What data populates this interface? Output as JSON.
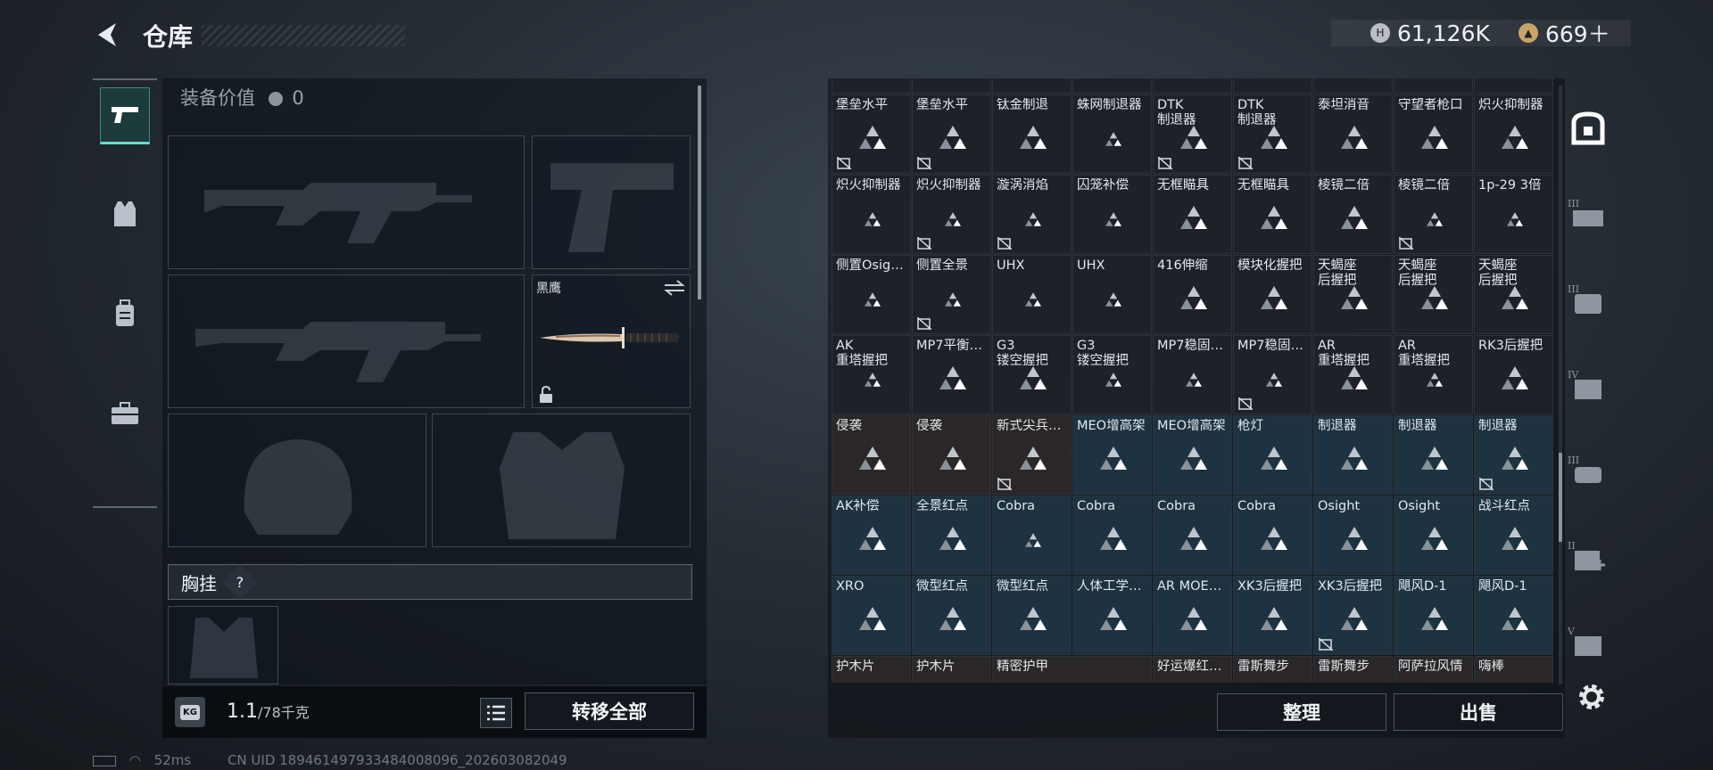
{
  "header": {
    "title": "仓库",
    "currency_1": "61,126K",
    "currency_2": "669＋"
  },
  "left_panel": {
    "equipment_value_label": "装备价值",
    "equipment_value": "0",
    "knife_name": "黑鹰",
    "chest_rig_label": "胸挂",
    "chest_rig_help": "?",
    "weight_current": "1.1",
    "weight_max": "/78千克",
    "weight_icon_label": "KG",
    "transfer_all_label": "转移全部"
  },
  "grid": {
    "rows": [
      [
        {
          "n": "堡垒水平",
          "t": 0,
          "s": 2,
          "x": 1
        },
        {
          "n": "堡垒水平",
          "t": 0,
          "s": 2,
          "x": 1
        },
        {
          "n": "钛金制退",
          "t": 0,
          "s": 2,
          "x": 0
        },
        {
          "n": "蛛网制退器",
          "t": 0,
          "s": 1,
          "x": 0
        },
        {
          "n": "DTK\n制退器",
          "t": 0,
          "s": 2,
          "x": 1
        },
        {
          "n": "DTK\n制退器",
          "t": 0,
          "s": 2,
          "x": 1
        },
        {
          "n": "泰坦消音",
          "t": 0,
          "s": 2,
          "x": 0
        },
        {
          "n": "守望者枪口",
          "t": 0,
          "s": 2,
          "x": 0
        },
        {
          "n": "炽火抑制器",
          "t": 0,
          "s": 2,
          "x": 0
        }
      ],
      [
        {
          "n": "炽火抑制器",
          "t": 0,
          "s": 1,
          "x": 0
        },
        {
          "n": "炽火抑制器",
          "t": 0,
          "s": 1,
          "x": 1
        },
        {
          "n": "漩涡消焰",
          "t": 0,
          "s": 1,
          "x": 1
        },
        {
          "n": "囚笼补偿",
          "t": 0,
          "s": 1,
          "x": 0
        },
        {
          "n": "无框瞄具",
          "t": 0,
          "s": 2,
          "x": 0
        },
        {
          "n": "无框瞄具",
          "t": 0,
          "s": 2,
          "x": 0
        },
        {
          "n": "棱镜二倍",
          "t": 0,
          "s": 2,
          "x": 0
        },
        {
          "n": "棱镜二倍",
          "t": 0,
          "s": 1,
          "x": 1
        },
        {
          "n": "1p-29 3倍",
          "t": 0,
          "s": 1,
          "x": 0
        }
      ],
      [
        {
          "n": "侧置Osig…",
          "t": 0,
          "s": 1,
          "x": 0
        },
        {
          "n": "侧置全景",
          "t": 0,
          "s": 1,
          "x": 1
        },
        {
          "n": "UHX",
          "t": 0,
          "s": 1,
          "x": 0
        },
        {
          "n": "UHX",
          "t": 0,
          "s": 1,
          "x": 0
        },
        {
          "n": "416伸缩",
          "t": 0,
          "s": 2,
          "x": 0
        },
        {
          "n": "模块化握把",
          "t": 0,
          "s": 2,
          "x": 0
        },
        {
          "n": "天蝎座\n后握把",
          "t": 0,
          "s": 2,
          "x": 0
        },
        {
          "n": "天蝎座\n后握把",
          "t": 0,
          "s": 2,
          "x": 0
        },
        {
          "n": "天蝎座\n后握把",
          "t": 0,
          "s": 2,
          "x": 0
        }
      ],
      [
        {
          "n": "AK\n重塔握把",
          "t": 0,
          "s": 1,
          "x": 0
        },
        {
          "n": "MP7平衡…",
          "t": 0,
          "s": 2,
          "x": 0
        },
        {
          "n": "G3\n镂空握把",
          "t": 0,
          "s": 2,
          "x": 0
        },
        {
          "n": "G3\n镂空握把",
          "t": 0,
          "s": 1,
          "x": 0
        },
        {
          "n": "MP7稳固…",
          "t": 0,
          "s": 1,
          "x": 0
        },
        {
          "n": "MP7稳固…",
          "t": 0,
          "s": 1,
          "x": 1
        },
        {
          "n": "AR\n重塔握把",
          "t": 0,
          "s": 2,
          "x": 0
        },
        {
          "n": "AR\n重塔握把",
          "t": 0,
          "s": 1,
          "x": 0
        },
        {
          "n": "RK3后握把",
          "t": 0,
          "s": 2,
          "x": 0
        }
      ],
      [
        {
          "n": "侵袭",
          "t": 2,
          "s": 2,
          "x": 0
        },
        {
          "n": "侵袭",
          "t": 2,
          "s": 2,
          "x": 0
        },
        {
          "n": "新式尖兵…",
          "t": 2,
          "s": 2,
          "x": 1
        },
        {
          "n": "MEO增高架",
          "t": 1,
          "s": 2,
          "x": 0
        },
        {
          "n": "MEO增高架",
          "t": 1,
          "s": 2,
          "x": 0
        },
        {
          "n": "枪灯",
          "t": 1,
          "s": 2,
          "x": 0
        },
        {
          "n": "制退器",
          "t": 1,
          "s": 2,
          "x": 0
        },
        {
          "n": "制退器",
          "t": 1,
          "s": 2,
          "x": 0
        },
        {
          "n": "制退器",
          "t": 1,
          "s": 2,
          "x": 1
        }
      ],
      [
        {
          "n": "AK补偿",
          "t": 1,
          "s": 2,
          "x": 0
        },
        {
          "n": "全景红点",
          "t": 1,
          "s": 2,
          "x": 0
        },
        {
          "n": "Cobra",
          "t": 1,
          "s": 1,
          "x": 0
        },
        {
          "n": "Cobra",
          "t": 1,
          "s": 2,
          "x": 0
        },
        {
          "n": "Cobra",
          "t": 1,
          "s": 2,
          "x": 0
        },
        {
          "n": "Cobra",
          "t": 1,
          "s": 2,
          "x": 0
        },
        {
          "n": "Osight",
          "t": 1,
          "s": 2,
          "x": 0
        },
        {
          "n": "Osight",
          "t": 1,
          "s": 2,
          "x": 0
        },
        {
          "n": "战斗红点",
          "t": 1,
          "s": 2,
          "x": 0
        }
      ],
      [
        {
          "n": "XRO",
          "t": 1,
          "s": 2,
          "x": 0
        },
        {
          "n": "微型红点",
          "t": 1,
          "s": 2,
          "x": 0
        },
        {
          "n": "微型红点",
          "t": 1,
          "s": 2,
          "x": 0
        },
        {
          "n": "人体工学…",
          "t": 1,
          "s": 2,
          "x": 0
        },
        {
          "n": "AR MOE…",
          "t": 1,
          "s": 2,
          "x": 0
        },
        {
          "n": "XK3后握把",
          "t": 1,
          "s": 2,
          "x": 0
        },
        {
          "n": "XK3后握把",
          "t": 1,
          "s": 2,
          "x": 1
        },
        {
          "n": "飓风D-1",
          "t": 1,
          "s": 2,
          "x": 0
        },
        {
          "n": "飓风D-1",
          "t": 1,
          "s": 2,
          "x": 0
        }
      ],
      [
        {
          "n": "护木片",
          "t": 2,
          "s": 0,
          "x": 0
        },
        {
          "n": "护木片",
          "t": 2,
          "s": 0,
          "x": 0
        },
        {
          "n": "精密护甲",
          "t": 2,
          "s": 0,
          "x": 0
        },
        {
          "n": "",
          "t": 2,
          "s": 0,
          "x": 0
        },
        {
          "n": "好运爆红…",
          "t": 2,
          "s": 0,
          "x": 0
        },
        {
          "n": "雷斯舞步",
          "t": 2,
          "s": 0,
          "x": 0
        },
        {
          "n": "雷斯舞步",
          "t": 2,
          "s": 0,
          "x": 0
        },
        {
          "n": "阿萨拉风情",
          "t": 2,
          "s": 0,
          "x": 0
        },
        {
          "n": "嗨棒",
          "t": 2,
          "s": 0,
          "x": 0
        }
      ]
    ]
  },
  "right_panel": {
    "organize_label": "整理",
    "sell_label": "出售"
  },
  "right_tabs": [
    {
      "icon": "safe-box-icon",
      "active": true
    },
    {
      "icon": "helmet-tier-iii-icon",
      "active": false
    },
    {
      "icon": "armor-tier-iii-icon",
      "active": false
    },
    {
      "icon": "backpack-tier-iv-icon",
      "active": false
    },
    {
      "icon": "chest-rig-tier-iii-icon",
      "active": false
    },
    {
      "icon": "medkit-tier-ii-icon",
      "active": false
    },
    {
      "icon": "tier-v-icon",
      "active": false
    }
  ],
  "status_bar": {
    "ping": "52ms",
    "uid": "CN UID 1894614979334840080​96_202603082049"
  },
  "colors": {
    "accent_teal": "#5fe0d0",
    "cell_default": "#1f2129",
    "cell_blue": "#1d3341",
    "cell_red": "#2b2728"
  }
}
